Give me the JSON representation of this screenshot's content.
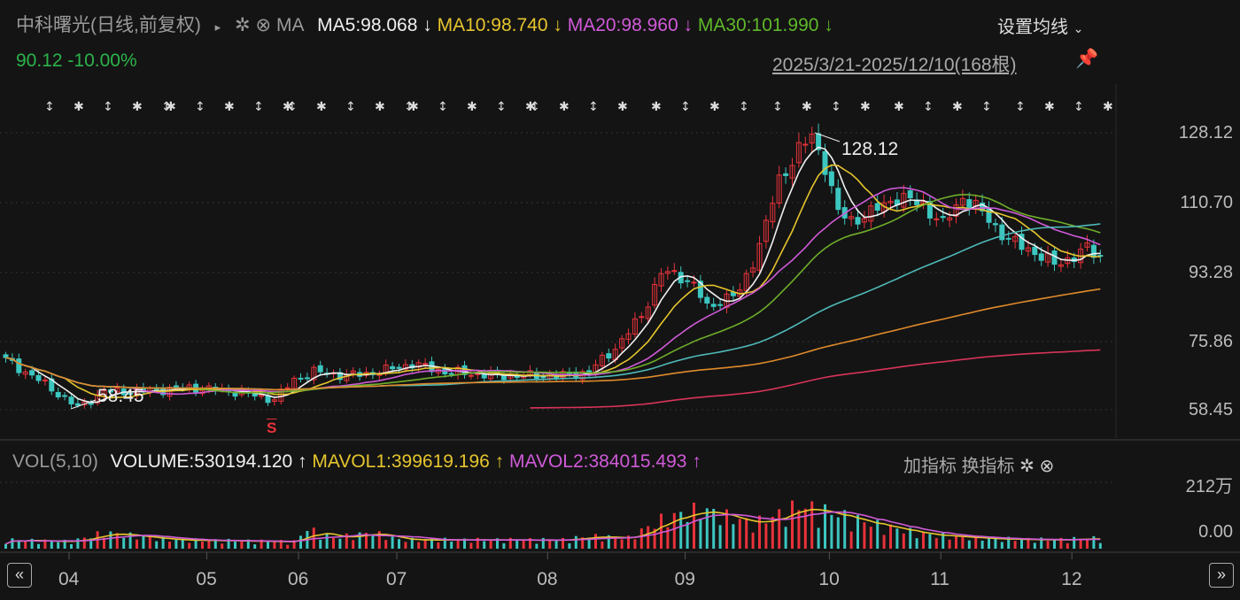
{
  "header": {
    "title": "中科曙光(日线,前复权)",
    "arrow": "▸",
    "ma_label": "MA",
    "ma5": "MA5:98.068",
    "ma5_dir": "↓",
    "ma10": "MA10:98.740",
    "ma10_dir": "↓",
    "ma20": "MA20:98.960",
    "ma20_dir": "↓",
    "ma30": "MA30:101.990",
    "ma30_dir": "↓",
    "settings_label": "设置均线",
    "price": "90.12",
    "change": "-10.00%",
    "range": "2025/3/21-2025/12/10(168根)"
  },
  "volume_panel": {
    "title": "VOL(5,10)",
    "volume": "VOLUME:530194.120",
    "volume_dir": "↑",
    "mavol1": "MAVOL1:399619.196",
    "mavol1_dir": "↑",
    "mavol2": "MAVOL2:384015.493",
    "mavol2_dir": "↑",
    "add_indicator": "加指标",
    "switch_indicator": "换指标",
    "axis_top": "212万",
    "axis_bottom": "0.00"
  },
  "nav": {
    "prev": "«",
    "next": "»"
  },
  "chart_data": {
    "type": "candlestick",
    "bar_count": 168,
    "y_ticks": [
      "128.12",
      "110.70",
      "93.28",
      "75.86",
      "58.45"
    ],
    "ylim": [
      58.45,
      128.12
    ],
    "x_ticks": [
      "04",
      "05",
      "06",
      "07",
      "08",
      "09",
      "10",
      "11",
      "12"
    ],
    "x_tick_bars": [
      10,
      31,
      45,
      60,
      83,
      104,
      126,
      143,
      163
    ],
    "annotations": {
      "high": "128.12",
      "low": "58.45",
      "signal": "S"
    },
    "close_keypoints": [
      [
        0,
        71
      ],
      [
        5,
        66
      ],
      [
        11,
        59
      ],
      [
        15,
        63
      ],
      [
        20,
        63
      ],
      [
        28,
        64
      ],
      [
        35,
        63
      ],
      [
        41,
        61
      ],
      [
        44,
        66
      ],
      [
        47,
        68
      ],
      [
        52,
        67
      ],
      [
        57,
        68
      ],
      [
        62,
        70
      ],
      [
        67,
        68
      ],
      [
        75,
        67
      ],
      [
        85,
        67
      ],
      [
        89,
        68
      ],
      [
        93,
        74
      ],
      [
        97,
        82
      ],
      [
        100,
        93
      ],
      [
        103,
        92
      ],
      [
        105,
        90
      ],
      [
        107,
        84
      ],
      [
        109,
        86
      ],
      [
        112,
        88
      ],
      [
        115,
        100
      ],
      [
        118,
        116
      ],
      [
        121,
        124
      ],
      [
        123,
        127
      ],
      [
        125,
        120
      ],
      [
        127,
        108
      ],
      [
        129,
        106
      ],
      [
        132,
        108
      ],
      [
        136,
        112
      ],
      [
        140,
        110
      ],
      [
        143,
        105
      ],
      [
        146,
        112
      ],
      [
        149,
        108
      ],
      [
        153,
        101
      ],
      [
        156,
        99
      ],
      [
        160,
        95
      ],
      [
        163,
        97
      ],
      [
        165,
        99
      ],
      [
        167,
        97
      ]
    ],
    "volume_keypoints_wan": [
      [
        0,
        25
      ],
      [
        10,
        20
      ],
      [
        15,
        45
      ],
      [
        25,
        25
      ],
      [
        44,
        20
      ],
      [
        46,
        55
      ],
      [
        50,
        30
      ],
      [
        56,
        45
      ],
      [
        60,
        25
      ],
      [
        85,
        25
      ],
      [
        89,
        35
      ],
      [
        95,
        30
      ],
      [
        100,
        80
      ],
      [
        106,
        110
      ],
      [
        110,
        90
      ],
      [
        114,
        70
      ],
      [
        118,
        95
      ],
      [
        121,
        120
      ],
      [
        126,
        100
      ],
      [
        132,
        70
      ],
      [
        140,
        40
      ],
      [
        150,
        28
      ],
      [
        160,
        25
      ],
      [
        167,
        30
      ]
    ],
    "volume_max_wan": 212,
    "series": [
      {
        "name": "MA5",
        "color": "#f0f0f0"
      },
      {
        "name": "MA10",
        "color": "#e6c52e"
      },
      {
        "name": "MA20",
        "color": "#d05ad8"
      },
      {
        "name": "MA30",
        "color": "#6fae2a"
      },
      {
        "name": "MA60",
        "color": "#4fb8b8"
      },
      {
        "name": "MA120",
        "color": "#e08a2a"
      },
      {
        "name": "MA250",
        "color": "#d8345a"
      }
    ],
    "colors": {
      "up": "#e8323a",
      "down": "#3cc6c0",
      "mavol1": "#e6c52e",
      "mavol2": "#d05ad8"
    }
  }
}
